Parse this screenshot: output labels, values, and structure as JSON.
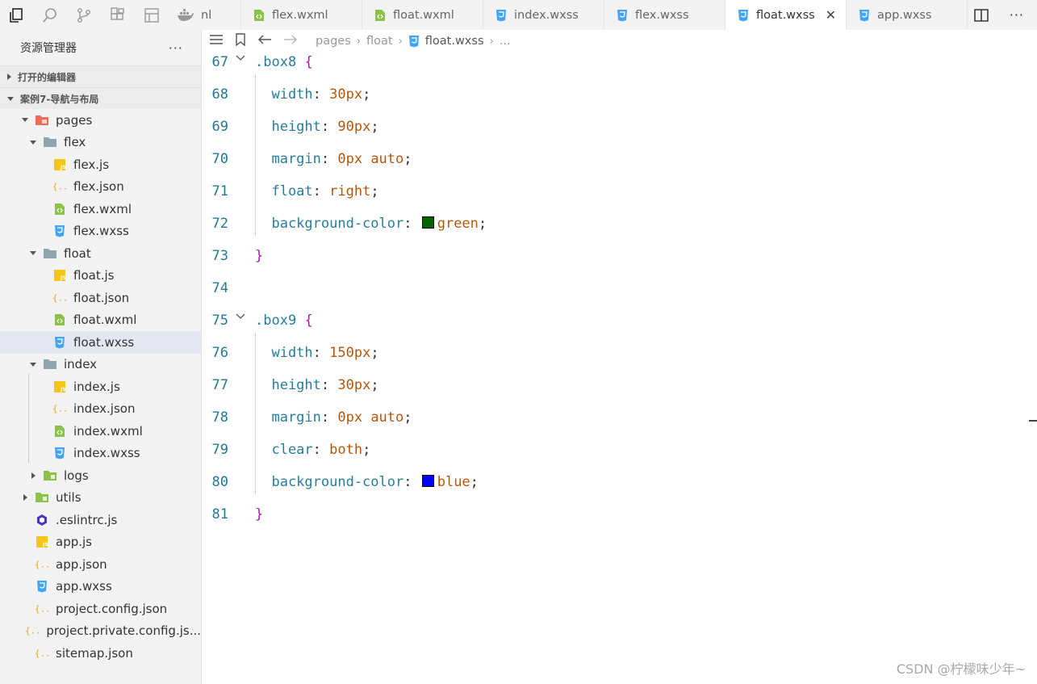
{
  "explorer": {
    "title": "资源管理器",
    "more": "···",
    "open_editors": "打开的编辑器",
    "project": "案例7-导航与布局"
  },
  "tree": [
    {
      "label": "pages",
      "depth": 0,
      "kind": "folder-pages",
      "expanded": true
    },
    {
      "label": "flex",
      "depth": 1,
      "kind": "folder",
      "expanded": true
    },
    {
      "label": "flex.js",
      "depth": 2,
      "kind": "js"
    },
    {
      "label": "flex.json",
      "depth": 2,
      "kind": "json"
    },
    {
      "label": "flex.wxml",
      "depth": 2,
      "kind": "wxml"
    },
    {
      "label": "flex.wxss",
      "depth": 2,
      "kind": "wxss"
    },
    {
      "label": "float",
      "depth": 1,
      "kind": "folder",
      "expanded": true
    },
    {
      "label": "float.js",
      "depth": 2,
      "kind": "js"
    },
    {
      "label": "float.json",
      "depth": 2,
      "kind": "json"
    },
    {
      "label": "float.wxml",
      "depth": 2,
      "kind": "wxml"
    },
    {
      "label": "float.wxss",
      "depth": 2,
      "kind": "wxss",
      "selected": true
    },
    {
      "label": "index",
      "depth": 1,
      "kind": "folder",
      "expanded": true
    },
    {
      "label": "index.js",
      "depth": 2,
      "kind": "js"
    },
    {
      "label": "index.json",
      "depth": 2,
      "kind": "json"
    },
    {
      "label": "index.wxml",
      "depth": 2,
      "kind": "wxml"
    },
    {
      "label": "index.wxss",
      "depth": 2,
      "kind": "wxss"
    },
    {
      "label": "logs",
      "depth": 1,
      "kind": "folder-logs",
      "expanded": false
    },
    {
      "label": "utils",
      "depth": 0,
      "kind": "folder-utils",
      "expanded": false
    },
    {
      "label": ".eslintrc.js",
      "depth": 0,
      "kind": "eslint"
    },
    {
      "label": "app.js",
      "depth": 0,
      "kind": "js"
    },
    {
      "label": "app.json",
      "depth": 0,
      "kind": "json"
    },
    {
      "label": "app.wxss",
      "depth": 0,
      "kind": "wxss"
    },
    {
      "label": "project.config.json",
      "depth": 0,
      "kind": "json"
    },
    {
      "label": "project.private.config.js...",
      "depth": 0,
      "kind": "json"
    },
    {
      "label": "sitemap.json",
      "depth": 0,
      "kind": "json"
    }
  ],
  "tabs": [
    {
      "label": "nl",
      "kind": "partial"
    },
    {
      "label": "flex.wxml",
      "kind": "wxml"
    },
    {
      "label": "float.wxml",
      "kind": "wxml"
    },
    {
      "label": "index.wxss",
      "kind": "wxss"
    },
    {
      "label": "flex.wxss",
      "kind": "wxss"
    },
    {
      "label": "float.wxss",
      "kind": "wxss",
      "active": true
    },
    {
      "label": "app.wxss",
      "kind": "wxss"
    }
  ],
  "breadcrumbs": [
    "pages",
    "float",
    "float.wxss",
    "..."
  ],
  "code_lines": [
    {
      "n": "67",
      "tokens": [
        {
          "t": ".box8",
          "c": "sel"
        },
        {
          "t": " ",
          "c": "punc"
        },
        {
          "t": "{",
          "c": "brace"
        }
      ],
      "fold": true
    },
    {
      "n": "68",
      "tokens": [
        {
          "t": "  width",
          "c": "prop"
        },
        {
          "t": ": ",
          "c": "punc"
        },
        {
          "t": "30px",
          "c": "val"
        },
        {
          "t": ";",
          "c": "punc"
        }
      ]
    },
    {
      "n": "69",
      "tokens": [
        {
          "t": "  height",
          "c": "prop"
        },
        {
          "t": ": ",
          "c": "punc"
        },
        {
          "t": "90px",
          "c": "val"
        },
        {
          "t": ";",
          "c": "punc"
        }
      ]
    },
    {
      "n": "70",
      "tokens": [
        {
          "t": "  margin",
          "c": "prop"
        },
        {
          "t": ": ",
          "c": "punc"
        },
        {
          "t": "0px auto",
          "c": "val"
        },
        {
          "t": ";",
          "c": "punc"
        }
      ]
    },
    {
      "n": "71",
      "tokens": [
        {
          "t": "  float",
          "c": "prop"
        },
        {
          "t": ": ",
          "c": "punc"
        },
        {
          "t": "right",
          "c": "val"
        },
        {
          "t": ";",
          "c": "punc"
        }
      ]
    },
    {
      "n": "72",
      "tokens": [
        {
          "t": "  background-color",
          "c": "prop"
        },
        {
          "t": ": ",
          "c": "punc"
        },
        {
          "swatch": "#006400"
        },
        {
          "t": "green",
          "c": "val"
        },
        {
          "t": ";",
          "c": "punc"
        }
      ]
    },
    {
      "n": "73",
      "tokens": [
        {
          "t": "}",
          "c": "brace"
        }
      ]
    },
    {
      "n": "74",
      "tokens": []
    },
    {
      "n": "75",
      "tokens": [
        {
          "t": ".box9",
          "c": "sel"
        },
        {
          "t": " ",
          "c": "punc"
        },
        {
          "t": "{",
          "c": "brace"
        }
      ],
      "fold": true
    },
    {
      "n": "76",
      "tokens": [
        {
          "t": "  width",
          "c": "prop"
        },
        {
          "t": ": ",
          "c": "punc"
        },
        {
          "t": "150px",
          "c": "val"
        },
        {
          "t": ";",
          "c": "punc"
        }
      ]
    },
    {
      "n": "77",
      "tokens": [
        {
          "t": "  height",
          "c": "prop"
        },
        {
          "t": ": ",
          "c": "punc"
        },
        {
          "t": "30px",
          "c": "val"
        },
        {
          "t": ";",
          "c": "punc"
        }
      ]
    },
    {
      "n": "78",
      "tokens": [
        {
          "t": "  margin",
          "c": "prop"
        },
        {
          "t": ": ",
          "c": "punc"
        },
        {
          "t": "0px auto",
          "c": "val"
        },
        {
          "t": ";",
          "c": "punc"
        }
      ]
    },
    {
      "n": "79",
      "tokens": [
        {
          "t": "  clear",
          "c": "prop"
        },
        {
          "t": ": ",
          "c": "punc"
        },
        {
          "t": "both",
          "c": "val"
        },
        {
          "t": ";",
          "c": "punc"
        }
      ]
    },
    {
      "n": "80",
      "tokens": [
        {
          "t": "  background-color",
          "c": "prop"
        },
        {
          "t": ": ",
          "c": "punc"
        },
        {
          "swatch": "#0000ff"
        },
        {
          "t": "blue",
          "c": "val"
        },
        {
          "t": ";",
          "c": "punc"
        }
      ]
    },
    {
      "n": "81",
      "tokens": [
        {
          "t": "}",
          "c": "brace"
        }
      ]
    }
  ],
  "watermark": "CSDN @柠檬味少年~",
  "colors": {
    "js": "#f5c518",
    "json": "#e8a317",
    "wxml": "#8bc34a",
    "wxss": "#42a5f5",
    "folder": "#90a4ae",
    "folder_pages": "#ef6c57",
    "folder_green": "#8bc34a",
    "eslint": "#4b32c3"
  }
}
